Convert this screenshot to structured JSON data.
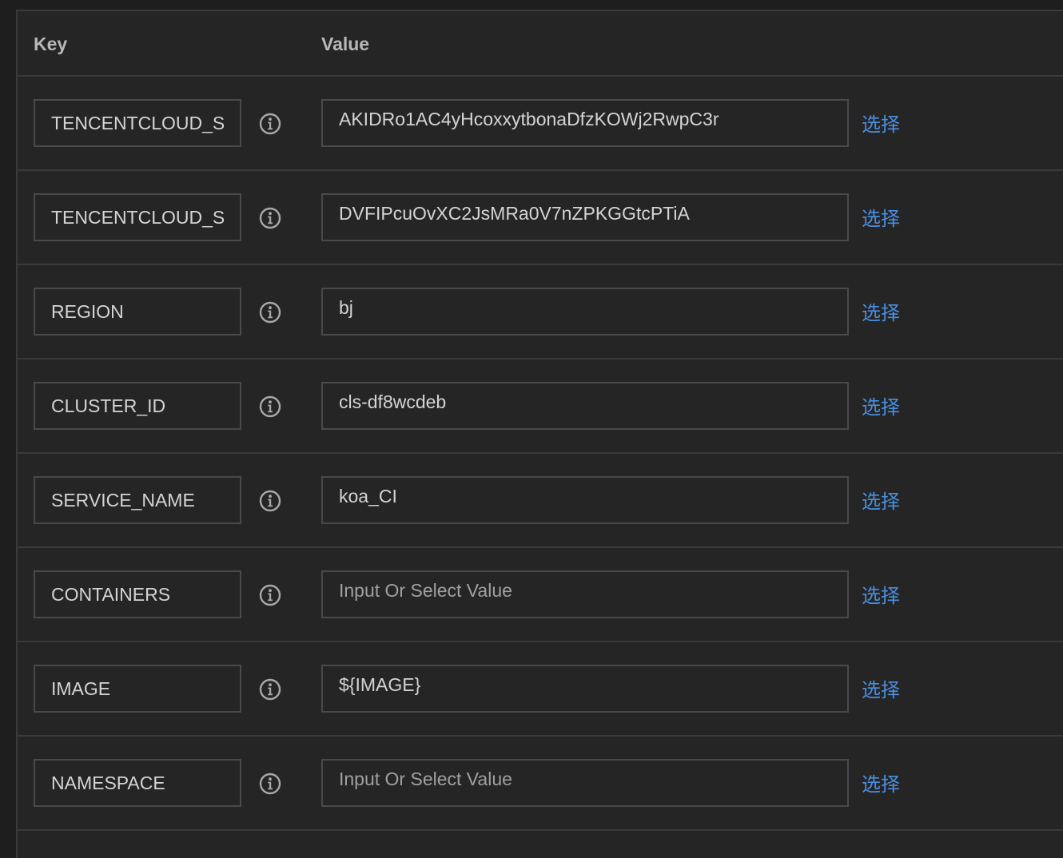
{
  "table": {
    "header": {
      "key_label": "Key",
      "value_label": "Value"
    },
    "select_label": "选择",
    "icon": "info-circle-icon",
    "colors": {
      "background": "#252526",
      "border": "#3a3a3c",
      "text": "#d4d4d4",
      "placeholder": "#a0a0a0",
      "link": "#4a8fe0"
    },
    "rows": [
      {
        "key": "TENCENTCLOUD_SECRET_ID",
        "value": "AKIDRo1AC4yHcoxxytbonaDfzKOWj2RwpC3r",
        "placeholder": ""
      },
      {
        "key": "TENCENTCLOUD_SECRET_KEY",
        "value": "DVFIPcuOvXC2JsMRa0V7nZPKGGtcPTiA",
        "placeholder": ""
      },
      {
        "key": "REGION",
        "value": "bj",
        "placeholder": ""
      },
      {
        "key": "CLUSTER_ID",
        "value": "cls-df8wcdeb",
        "placeholder": ""
      },
      {
        "key": "SERVICE_NAME",
        "value": "koa_CI",
        "placeholder": ""
      },
      {
        "key": "CONTAINERS",
        "value": "",
        "placeholder": "Input Or Select Value"
      },
      {
        "key": "IMAGE",
        "value": "${IMAGE}",
        "placeholder": ""
      },
      {
        "key": "NAMESPACE",
        "value": "",
        "placeholder": "Input Or Select Value"
      }
    ]
  }
}
